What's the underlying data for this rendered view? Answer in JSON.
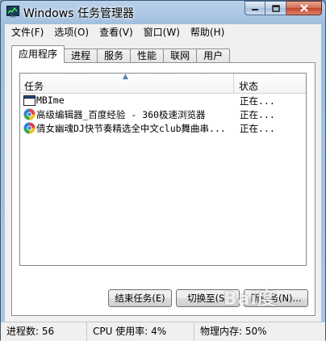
{
  "window": {
    "title": "Windows 任务管理器"
  },
  "caption_buttons": {
    "minimize": "minimize",
    "maximize": "maximize",
    "close": "close"
  },
  "menu": [
    {
      "label": "文件(F)"
    },
    {
      "label": "选项(O)"
    },
    {
      "label": "查看(V)"
    },
    {
      "label": "窗口(W)"
    },
    {
      "label": "帮助(H)"
    }
  ],
  "tabs": [
    {
      "label": "应用程序",
      "active": true
    },
    {
      "label": "进程",
      "active": false
    },
    {
      "label": "服务",
      "active": false
    },
    {
      "label": "性能",
      "active": false
    },
    {
      "label": "联网",
      "active": false
    },
    {
      "label": "用户",
      "active": false
    }
  ],
  "list": {
    "columns": {
      "task": "任务",
      "status": "状态"
    },
    "sort_indicator": "▲",
    "rows": [
      {
        "name": "MBIme",
        "status": "正在...",
        "icon": "window-icon"
      },
      {
        "name": "高级编辑器_百度经验 - 360极速浏览器",
        "status": "正在...",
        "icon": "browser-icon"
      },
      {
        "name": "倩女幽魂DJ快节奏精选全中文club舞曲串...",
        "status": "正在...",
        "icon": "browser-icon"
      }
    ]
  },
  "buttons": {
    "end_task": "结束任务(E)",
    "switch_to": "切换至(S)",
    "new_task": "新任务(N)..."
  },
  "statusbar": {
    "processes": "进程数: 56",
    "cpu": "CPU 使用率: 4%",
    "memory": "物理内存: 50%"
  },
  "colors": {
    "titlebar": "#b9d1ea",
    "close_button": "#c4412a",
    "panel": "#f0f0f0"
  },
  "watermark": {
    "text": "Bai度"
  }
}
